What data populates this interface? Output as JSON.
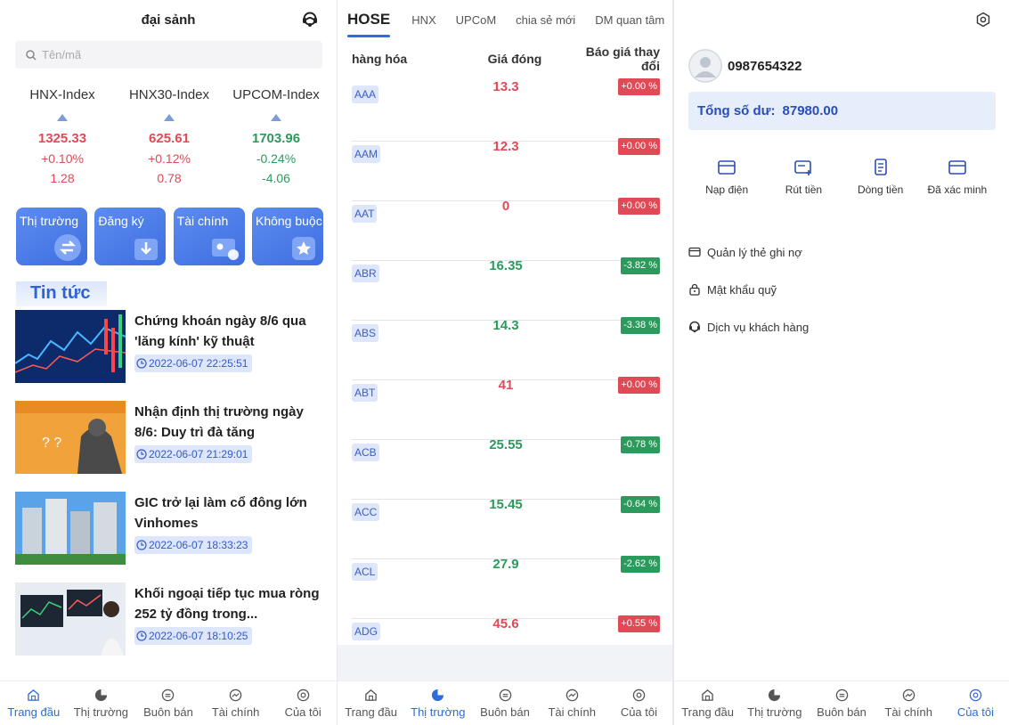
{
  "home": {
    "title": "đại sảnh",
    "search_placeholder": "Tên/mã",
    "indexes": [
      {
        "name": "HNX-Index",
        "value": "1325.33",
        "pct": "+0.10%",
        "change": "1.28",
        "trend": "up"
      },
      {
        "name": "HNX30-Index",
        "value": "625.61",
        "pct": "+0.12%",
        "change": "0.78",
        "trend": "up"
      },
      {
        "name": "UPCOM-Index",
        "value": "1703.96",
        "pct": "-0.24%",
        "change": "-4.06",
        "trend": "down"
      }
    ],
    "quick": [
      "Thị trường",
      "Đăng ký",
      "Tài chính",
      "Không buộc"
    ],
    "news_title": "Tin tức",
    "news": [
      {
        "title": "Chứng khoán ngày 8/6 qua 'lăng kính' kỹ thuật",
        "time": "2022-06-07 22:25:51"
      },
      {
        "title": "Nhận định thị trường ngày 8/6: Duy trì đà tăng",
        "time": "2022-06-07 21:29:01"
      },
      {
        "title": "GIC trở lại làm cổ đông lớn Vinhomes",
        "time": "2022-06-07 18:33:23"
      },
      {
        "title": "Khối ngoại tiếp tục mua ròng 252 tỷ đồng trong...",
        "time": "2022-06-07 18:10:25"
      }
    ]
  },
  "market": {
    "tabs": [
      "HOSE",
      "HNX",
      "UPCoM",
      "chia sẻ mới",
      "DM quan tâm"
    ],
    "headers": {
      "code": "hàng hóa",
      "price": "Giá đóng",
      "change": "Báo giá thay đổi"
    },
    "rows": [
      {
        "code": "AAA",
        "price": "13.3",
        "change": "+0.00 %",
        "trend": "up"
      },
      {
        "code": "AAM",
        "price": "12.3",
        "change": "+0.00 %",
        "trend": "up"
      },
      {
        "code": "AAT",
        "price": "0",
        "change": "+0.00 %",
        "trend": "up"
      },
      {
        "code": "ABR",
        "price": "16.35",
        "change": "-3.82 %",
        "trend": "down"
      },
      {
        "code": "ABS",
        "price": "14.3",
        "change": "-3.38 %",
        "trend": "down"
      },
      {
        "code": "ABT",
        "price": "41",
        "change": "+0.00 %",
        "trend": "up"
      },
      {
        "code": "ACB",
        "price": "25.55",
        "change": "-0.78 %",
        "trend": "down"
      },
      {
        "code": "ACC",
        "price": "15.45",
        "change": "-0.64 %",
        "trend": "down"
      },
      {
        "code": "ACL",
        "price": "27.9",
        "change": "-2.62 %",
        "trend": "down"
      },
      {
        "code": "ADG",
        "price": "45.6",
        "change": "+0.55 %",
        "trend": "up"
      }
    ]
  },
  "profile": {
    "phone": "0987654322",
    "balance_label": "Tổng số dư:",
    "balance_value": "87980.00",
    "actions": [
      "Nạp điện",
      "Rút tiền",
      "Dòng tiền",
      "Đã xác minh"
    ],
    "menu": [
      "Quản lý thẻ ghi nợ",
      "Mật khẩu quỹ",
      "Dịch vụ khách hàng"
    ]
  },
  "nav": [
    "Trang đầu",
    "Thị trường",
    "Buôn bán",
    "Tài chính",
    "Của tôi"
  ],
  "colors": {
    "accent": "#2f6bd9",
    "up": "#e04a56",
    "down": "#2c9a5c"
  }
}
